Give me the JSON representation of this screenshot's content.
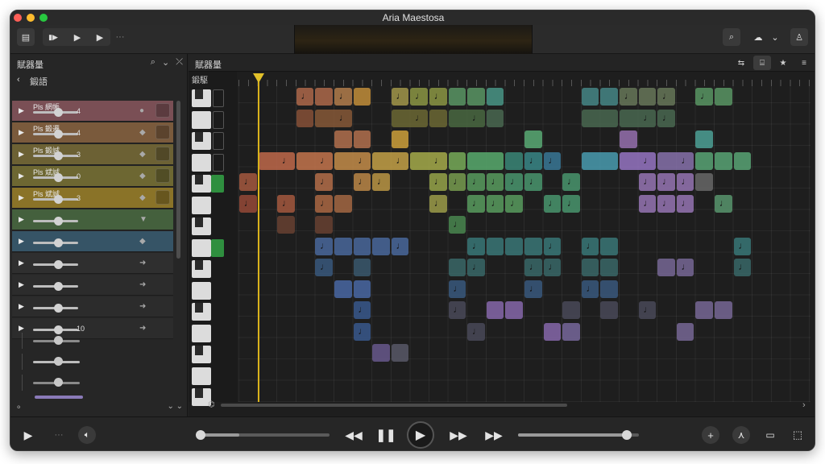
{
  "window": {
    "title": "Aria Maestosa"
  },
  "toolbar": {
    "left": [
      {
        "name": "tracks-view-icon",
        "glyph": "▤"
      },
      {
        "name": "go-to-start-icon",
        "glyph": "▮▶"
      },
      {
        "name": "play-icon",
        "glyph": "▶"
      },
      {
        "name": "forward-icon",
        "glyph": "▶"
      },
      {
        "name": "more-icon",
        "glyph": "···"
      }
    ],
    "right": [
      {
        "name": "search-icon",
        "glyph": "⌕"
      },
      {
        "name": "cloud-icon",
        "glyph": "☁"
      },
      {
        "name": "chevron-down-icon",
        "glyph": "⌄"
      },
      {
        "name": "user-icon",
        "glyph": "♙"
      }
    ]
  },
  "left_panel": {
    "title": "賦器量",
    "tools": [
      "⌕",
      "⌄",
      "⤫"
    ],
    "sub": {
      "back": "‹",
      "label": "鍛語"
    },
    "tracks": [
      {
        "label": "Pls 網帳",
        "number": "4",
        "color": "#7a4f55",
        "icon": "●"
      },
      {
        "label": "Pls 鍛遷",
        "number": "4",
        "color": "#7a5a3c",
        "icon": "◆"
      },
      {
        "label": "Pls 鍛誠",
        "number": "3",
        "color": "#6c6134",
        "icon": "◆"
      },
      {
        "label": "Pls 斌誠",
        "number": "0",
        "color": "#6d6732",
        "icon": "◆"
      },
      {
        "label": "Pls 斌誠",
        "number": "3",
        "color": "#8a7328",
        "icon": "◆"
      },
      {
        "label": "",
        "number": "",
        "color": "#44603d",
        "icon": "▼"
      },
      {
        "label": "",
        "number": "",
        "color": "#365466",
        "icon": "◆"
      },
      {
        "label": "",
        "number": "",
        "color": "#2f2f2f",
        "icon": "➜"
      },
      {
        "label": "",
        "number": "",
        "color": "#2c2c2c",
        "icon": "➜"
      },
      {
        "label": "",
        "number": "",
        "color": "#2c2c2c",
        "icon": "➜"
      },
      {
        "label": "",
        "number": "10",
        "color": "#2c2c2c",
        "icon": "➜"
      }
    ],
    "bottom_left": "⚬",
    "bottom_right": "⌄  ⌄"
  },
  "main": {
    "title": "賦器量",
    "keys_header": "鍛駆",
    "tools": [
      {
        "name": "share-icon",
        "glyph": "⇆"
      },
      {
        "name": "select-tool-icon",
        "glyph": "⌸"
      },
      {
        "name": "star-icon",
        "glyph": "★"
      },
      {
        "name": "list-icon",
        "glyph": "≡"
      }
    ],
    "scroll_icon": "⌬",
    "scroll_arrow": "›"
  },
  "notes": [
    {
      "r": 1,
      "s": 3,
      "l": 1,
      "c": "#b26b4c",
      "m": 1
    },
    {
      "r": 1,
      "s": 4,
      "l": 1,
      "c": "#b26b4c"
    },
    {
      "r": 1,
      "s": 5,
      "l": 1,
      "c": "#b7804e",
      "m": 1
    },
    {
      "r": 1,
      "s": 6,
      "l": 1,
      "c": "#c7913a"
    },
    {
      "r": 1,
      "s": 8,
      "l": 1,
      "c": "#a79b4c",
      "m": 1
    },
    {
      "r": 1,
      "s": 9,
      "l": 1,
      "c": "#8f9a45",
      "m": 1
    },
    {
      "r": 1,
      "s": 10,
      "l": 1,
      "c": "#8f9a45",
      "m": 1
    },
    {
      "r": 1,
      "s": 11,
      "l": 1,
      "c": "#5b9a66"
    },
    {
      "r": 1,
      "s": 12,
      "l": 1,
      "c": "#5b9a66"
    },
    {
      "r": 1,
      "s": 13,
      "l": 1,
      "c": "#4a9a8a"
    },
    {
      "r": 1,
      "s": 18,
      "l": 1,
      "c": "#478a8a"
    },
    {
      "r": 1,
      "s": 19,
      "l": 1,
      "c": "#478a8a"
    },
    {
      "r": 1,
      "s": 20,
      "l": 1,
      "c": "#6a7a5b",
      "m": 1
    },
    {
      "r": 1,
      "s": 21,
      "l": 1,
      "c": "#6a7a5b"
    },
    {
      "r": 1,
      "s": 22,
      "l": 1,
      "c": "#6a7a5b",
      "m": 1
    },
    {
      "r": 1,
      "s": 24,
      "l": 1,
      "c": "#5b9a66",
      "m": 1
    },
    {
      "r": 1,
      "s": 25,
      "l": 1,
      "c": "#5b9a66"
    },
    {
      "r": 2,
      "s": 3,
      "l": 1,
      "c": "#8a5238"
    },
    {
      "r": 2,
      "s": 4,
      "l": 2,
      "c": "#8a5a38",
      "m": 1
    },
    {
      "r": 2,
      "s": 8,
      "l": 2,
      "c": "#6e6a34",
      "m": 1
    },
    {
      "r": 2,
      "s": 10,
      "l": 1,
      "c": "#6e6a34"
    },
    {
      "r": 2,
      "s": 11,
      "l": 2,
      "c": "#4a6a42",
      "m": 1
    },
    {
      "r": 2,
      "s": 13,
      "l": 1,
      "c": "#4a6a52"
    },
    {
      "r": 2,
      "s": 18,
      "l": 2,
      "c": "#4a6a52"
    },
    {
      "r": 2,
      "s": 20,
      "l": 2,
      "c": "#4a6a52",
      "m": 1
    },
    {
      "r": 2,
      "s": 22,
      "l": 1,
      "c": "#4a6a52",
      "m": 1
    },
    {
      "r": 3,
      "s": 5,
      "l": 1,
      "c": "#b7734f"
    },
    {
      "r": 3,
      "s": 6,
      "l": 1,
      "c": "#b7734f"
    },
    {
      "r": 3,
      "s": 8,
      "l": 1,
      "c": "#d3a53c"
    },
    {
      "r": 3,
      "s": 15,
      "l": 1,
      "c": "#5bb078"
    },
    {
      "r": 3,
      "s": 20,
      "l": 1,
      "c": "#9a73b3"
    },
    {
      "r": 3,
      "s": 24,
      "l": 1,
      "c": "#4ea59a"
    },
    {
      "r": 4,
      "s": 1,
      "l": 2,
      "c": "#c46b4c",
      "m": 1
    },
    {
      "r": 4,
      "s": 3,
      "l": 2,
      "c": "#c9784e",
      "m": 1
    },
    {
      "r": 4,
      "s": 5,
      "l": 2,
      "c": "#c9904a",
      "m": 1
    },
    {
      "r": 4,
      "s": 7,
      "l": 2,
      "c": "#c9a548",
      "m": 1
    },
    {
      "r": 4,
      "s": 9,
      "l": 2,
      "c": "#aab04c",
      "m": 1
    },
    {
      "r": 4,
      "s": 11,
      "l": 1,
      "c": "#7ab05a"
    },
    {
      "r": 4,
      "s": 12,
      "l": 2,
      "c": "#5ab070"
    },
    {
      "r": 4,
      "s": 14,
      "l": 1,
      "c": "#3a8a7a"
    },
    {
      "r": 4,
      "s": 15,
      "l": 1,
      "c": "#3a8a8a",
      "m": 1
    },
    {
      "r": 4,
      "s": 16,
      "l": 1,
      "c": "#3a7a9a",
      "m": 1
    },
    {
      "r": 4,
      "s": 18,
      "l": 2,
      "c": "#4aa0b5"
    },
    {
      "r": 4,
      "s": 20,
      "l": 2,
      "c": "#9a78c8",
      "m": 1
    },
    {
      "r": 4,
      "s": 22,
      "l": 2,
      "c": "#8a74b0",
      "m": 1
    },
    {
      "r": 4,
      "s": 24,
      "l": 1,
      "c": "#5aa878"
    },
    {
      "r": 4,
      "s": 25,
      "l": 1,
      "c": "#5aa878"
    },
    {
      "r": 4,
      "s": 26,
      "l": 1,
      "c": "#5aa878"
    },
    {
      "r": 5,
      "s": 0,
      "l": 1,
      "c": "#a85a40",
      "m": 1
    },
    {
      "r": 5,
      "s": 4,
      "l": 1,
      "c": "#b8704a",
      "m": 1
    },
    {
      "r": 5,
      "s": 6,
      "l": 1,
      "c": "#c08a48",
      "m": 1
    },
    {
      "r": 5,
      "s": 7,
      "l": 1,
      "c": "#c09a46",
      "m": 1
    },
    {
      "r": 5,
      "s": 10,
      "l": 1,
      "c": "#9aa84a",
      "m": 1
    },
    {
      "r": 5,
      "s": 11,
      "l": 1,
      "c": "#7aa050",
      "m": 1
    },
    {
      "r": 5,
      "s": 12,
      "l": 1,
      "c": "#5aa060",
      "m": 1
    },
    {
      "r": 5,
      "s": 13,
      "l": 1,
      "c": "#5aa060",
      "m": 1
    },
    {
      "r": 5,
      "s": 14,
      "l": 1,
      "c": "#4a9a70",
      "m": 1
    },
    {
      "r": 5,
      "s": 15,
      "l": 1,
      "c": "#4a9a70",
      "m": 1
    },
    {
      "r": 5,
      "s": 17,
      "l": 1,
      "c": "#4a9a70",
      "m": 1
    },
    {
      "r": 5,
      "s": 21,
      "l": 1,
      "c": "#9a78b8",
      "m": 1
    },
    {
      "r": 5,
      "s": 22,
      "l": 1,
      "c": "#9a78b8",
      "m": 1
    },
    {
      "r": 5,
      "s": 23,
      "l": 1,
      "c": "#9a78b8",
      "m": 1
    },
    {
      "r": 5,
      "s": 24,
      "l": 1,
      "c": "#6a6a6a"
    },
    {
      "r": 6,
      "s": 0,
      "l": 1,
      "c": "#9a4a38",
      "m": 1
    },
    {
      "r": 6,
      "s": 2,
      "l": 1,
      "c": "#a85a40",
      "m": 1
    },
    {
      "r": 6,
      "s": 4,
      "l": 1,
      "c": "#b06a44",
      "m": 1
    },
    {
      "r": 6,
      "s": 5,
      "l": 1,
      "c": "#a86a44"
    },
    {
      "r": 6,
      "s": 10,
      "l": 1,
      "c": "#a0a04a",
      "m": 1
    },
    {
      "r": 6,
      "s": 12,
      "l": 1,
      "c": "#5aa060",
      "m": 1
    },
    {
      "r": 6,
      "s": 13,
      "l": 1,
      "c": "#5aa060",
      "m": 1
    },
    {
      "r": 6,
      "s": 14,
      "l": 1,
      "c": "#5aa060",
      "m": 1
    },
    {
      "r": 6,
      "s": 16,
      "l": 1,
      "c": "#4a9a70",
      "m": 1
    },
    {
      "r": 6,
      "s": 17,
      "l": 1,
      "c": "#4a9a70",
      "m": 1
    },
    {
      "r": 6,
      "s": 21,
      "l": 1,
      "c": "#9a78b8",
      "m": 1
    },
    {
      "r": 6,
      "s": 22,
      "l": 1,
      "c": "#9a78b8",
      "m": 1
    },
    {
      "r": 6,
      "s": 23,
      "l": 1,
      "c": "#9a78b8",
      "m": 1
    },
    {
      "r": 6,
      "s": 25,
      "l": 1,
      "c": "#5a9a70",
      "m": 1
    },
    {
      "r": 7,
      "s": 2,
      "l": 1,
      "c": "#6a4232"
    },
    {
      "r": 7,
      "s": 4,
      "l": 1,
      "c": "#6a4232"
    },
    {
      "r": 7,
      "s": 11,
      "l": 1,
      "c": "#4a8a50",
      "m": 1
    },
    {
      "r": 8,
      "s": 4,
      "l": 1,
      "c": "#4a6aa0",
      "m": 1
    },
    {
      "r": 8,
      "s": 5,
      "l": 1,
      "c": "#4a6aa0"
    },
    {
      "r": 8,
      "s": 6,
      "l": 1,
      "c": "#4a6aa0"
    },
    {
      "r": 8,
      "s": 7,
      "l": 1,
      "c": "#4a6aa0"
    },
    {
      "r": 8,
      "s": 8,
      "l": 1,
      "c": "#4a6aa0",
      "m": 1
    },
    {
      "r": 8,
      "s": 12,
      "l": 1,
      "c": "#3a7a7a",
      "m": 1
    },
    {
      "r": 8,
      "s": 13,
      "l": 1,
      "c": "#3a7a7a"
    },
    {
      "r": 8,
      "s": 14,
      "l": 1,
      "c": "#3a7a7a"
    },
    {
      "r": 8,
      "s": 15,
      "l": 1,
      "c": "#3a7a7a"
    },
    {
      "r": 8,
      "s": 16,
      "l": 1,
      "c": "#3a7a7a",
      "m": 1
    },
    {
      "r": 8,
      "s": 18,
      "l": 1,
      "c": "#3a7a7a",
      "m": 1
    },
    {
      "r": 8,
      "s": 19,
      "l": 1,
      "c": "#3a7a7a"
    },
    {
      "r": 8,
      "s": 26,
      "l": 1,
      "c": "#3a7a7a",
      "m": 1
    },
    {
      "r": 9,
      "s": 4,
      "l": 1,
      "c": "#3a5a80",
      "m": 1
    },
    {
      "r": 9,
      "s": 6,
      "l": 1,
      "c": "#3a5a70"
    },
    {
      "r": 9,
      "s": 11,
      "l": 1,
      "c": "#3a6a6a"
    },
    {
      "r": 9,
      "s": 12,
      "l": 1,
      "c": "#3a6a6a",
      "m": 1
    },
    {
      "r": 9,
      "s": 15,
      "l": 1,
      "c": "#3a6a6a",
      "m": 1
    },
    {
      "r": 9,
      "s": 16,
      "l": 1,
      "c": "#3a6a6a",
      "m": 1
    },
    {
      "r": 9,
      "s": 18,
      "l": 1,
      "c": "#3a6a6a"
    },
    {
      "r": 9,
      "s": 19,
      "l": 1,
      "c": "#3a6a6a"
    },
    {
      "r": 9,
      "s": 22,
      "l": 1,
      "c": "#7a6a9a"
    },
    {
      "r": 9,
      "s": 23,
      "l": 1,
      "c": "#7a6a9a",
      "m": 1
    },
    {
      "r": 9,
      "s": 26,
      "l": 1,
      "c": "#3a6a6a",
      "m": 1
    },
    {
      "r": 10,
      "s": 5,
      "l": 1,
      "c": "#4a6aa8"
    },
    {
      "r": 10,
      "s": 6,
      "l": 1,
      "c": "#4a6aa8"
    },
    {
      "r": 10,
      "s": 11,
      "l": 1,
      "c": "#3a5a80",
      "m": 1
    },
    {
      "r": 10,
      "s": 15,
      "l": 1,
      "c": "#3a5a80",
      "m": 1
    },
    {
      "r": 10,
      "s": 18,
      "l": 1,
      "c": "#3a5a80",
      "m": 1
    },
    {
      "r": 10,
      "s": 19,
      "l": 1,
      "c": "#3a5a80"
    },
    {
      "r": 11,
      "s": 6,
      "l": 1,
      "c": "#3a5a90",
      "m": 1
    },
    {
      "r": 11,
      "s": 11,
      "l": 1,
      "c": "#4a4a5a",
      "m": 1
    },
    {
      "r": 11,
      "s": 13,
      "l": 1,
      "c": "#8a6ab0"
    },
    {
      "r": 11,
      "s": 14,
      "l": 1,
      "c": "#8a6ab0"
    },
    {
      "r": 11,
      "s": 17,
      "l": 1,
      "c": "#4a4a5a"
    },
    {
      "r": 11,
      "s": 19,
      "l": 1,
      "c": "#4a4a5a"
    },
    {
      "r": 11,
      "s": 21,
      "l": 1,
      "c": "#4a4a5a",
      "m": 1
    },
    {
      "r": 11,
      "s": 24,
      "l": 1,
      "c": "#7a6a9a"
    },
    {
      "r": 11,
      "s": 25,
      "l": 1,
      "c": "#7a6a9a"
    },
    {
      "r": 12,
      "s": 6,
      "l": 1,
      "c": "#3a5a90",
      "m": 1
    },
    {
      "r": 12,
      "s": 12,
      "l": 1,
      "c": "#4a4a5a",
      "m": 1
    },
    {
      "r": 12,
      "s": 16,
      "l": 1,
      "c": "#8a6ab0"
    },
    {
      "r": 12,
      "s": 17,
      "l": 1,
      "c": "#7a6aa0"
    },
    {
      "r": 12,
      "s": 23,
      "l": 1,
      "c": "#7a6a9a"
    },
    {
      "r": 13,
      "s": 7,
      "l": 1,
      "c": "#6a5a90"
    },
    {
      "r": 13,
      "s": 8,
      "l": 1,
      "c": "#5a5a6a"
    }
  ],
  "transport": {
    "progress_a": 0.55,
    "progress_b": 0.9
  }
}
